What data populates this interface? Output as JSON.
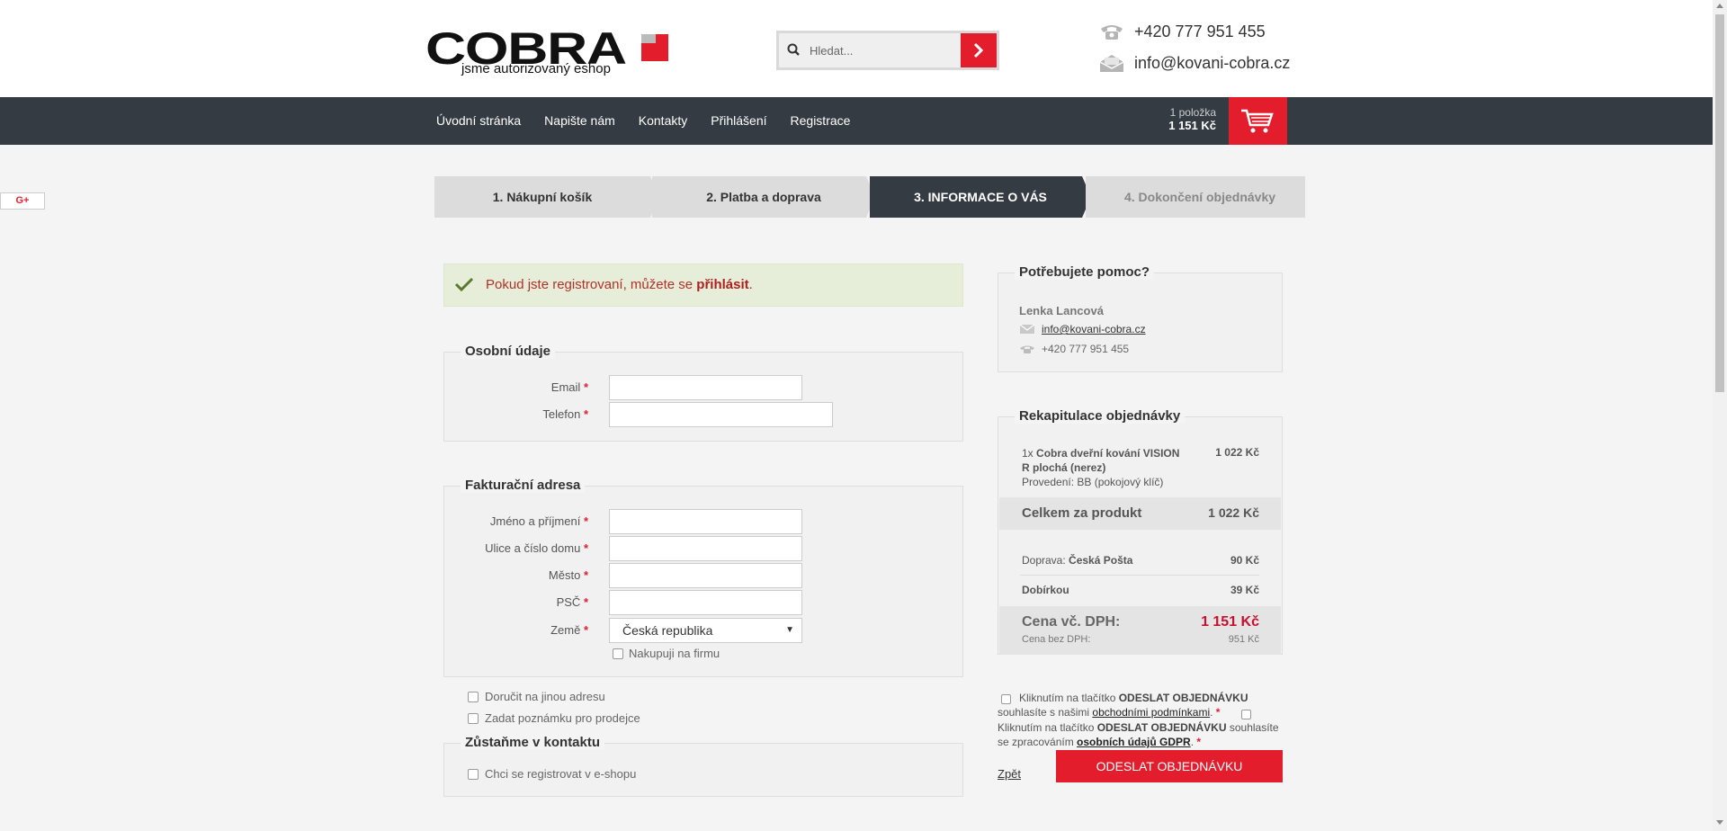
{
  "header": {
    "logo_text": "COBRA",
    "logo_tagline": "jsme autorizovaný eshop",
    "search_placeholder": "Hledat...",
    "phone": "+420 777 951 455",
    "email": "info@kovani-cobra.cz"
  },
  "nav": {
    "items": [
      "Úvodní stránka",
      "Napište nám",
      "Kontakty",
      "Přihlášení",
      "Registrace"
    ],
    "cart_count": "1 položka",
    "cart_total": "1 151 Kč"
  },
  "social": {
    "gplus_label": "G+"
  },
  "steps": [
    "1. Nákupní košík",
    "2. Platba a doprava",
    "3. INFORMACE O VÁS",
    "4. Dokončení objednávky"
  ],
  "notice": {
    "text": "Pokud jste registrovaní, můžete se ",
    "link": "přihlásit",
    "suffix": "."
  },
  "personal": {
    "legend": "Osobní údaje",
    "email_label": "Email",
    "phone_label": "Telefon"
  },
  "billing": {
    "legend": "Fakturační adresa",
    "name_label": "Jméno a příjmení",
    "street_label": "Ulice a číslo domu",
    "city_label": "Město",
    "zip_label": "PSČ",
    "country_label": "Země",
    "country_value": "Česká republika",
    "company_label": "Nakupuji na firmu"
  },
  "options": {
    "other_address": "Doručit na jinou adresu",
    "note": "Zadat poznámku pro prodejce"
  },
  "keep_in_touch": {
    "legend": "Zůstaňme v kontaktu",
    "register_label": "Chci se registrovat v e-shopu"
  },
  "help": {
    "title": "Potřebujete pomoc?",
    "name": "Lenka Lancová",
    "email": "info@kovani-cobra.cz",
    "phone": "+420 777 951 455"
  },
  "recap": {
    "title": "Rekapitulace objednávky",
    "item_qty": "1x",
    "item_name_1": "Cobra dveřní kování VISION",
    "item_name_2": "R plochá (nerez)",
    "item_variant": "Provedení: BB (pokojový klíč)",
    "item_price": "1 022 Kč",
    "product_total_label": "Celkem za produkt",
    "product_total": "1 022 Kč",
    "shipping_label": "Doprava:",
    "shipping_name": "Česká Pošta",
    "shipping_price": "90 Kč",
    "cod_label": "Dobírkou",
    "cod_price": "39 Kč",
    "total_vat_label": "Cena vč. DPH:",
    "total_vat": "1 151 Kč",
    "total_novat_label": "Cena bez DPH:",
    "total_novat": "951 Kč"
  },
  "agreement": {
    "terms_prefix": "Kliknutím na tlačítko ",
    "button_name": "ODESLAT OBJEDNÁVKU",
    "terms_mid": "souhlasíte s našimi ",
    "terms_link": "obchodními podmínkami",
    "gdpr_prefix": "Kliknutím na tlačítko ",
    "gdpr_mid": " souhlasíte",
    "gdpr_mid2": "se zpracováním ",
    "gdpr_link": "osobních údajů GDPR"
  },
  "actions": {
    "back": "Zpět",
    "submit": "ODESLAT OBJEDNÁVKU"
  },
  "colors": {
    "accent": "#e41d2d",
    "nav_bg": "#343b42",
    "notice_bg": "#e6eed9"
  }
}
